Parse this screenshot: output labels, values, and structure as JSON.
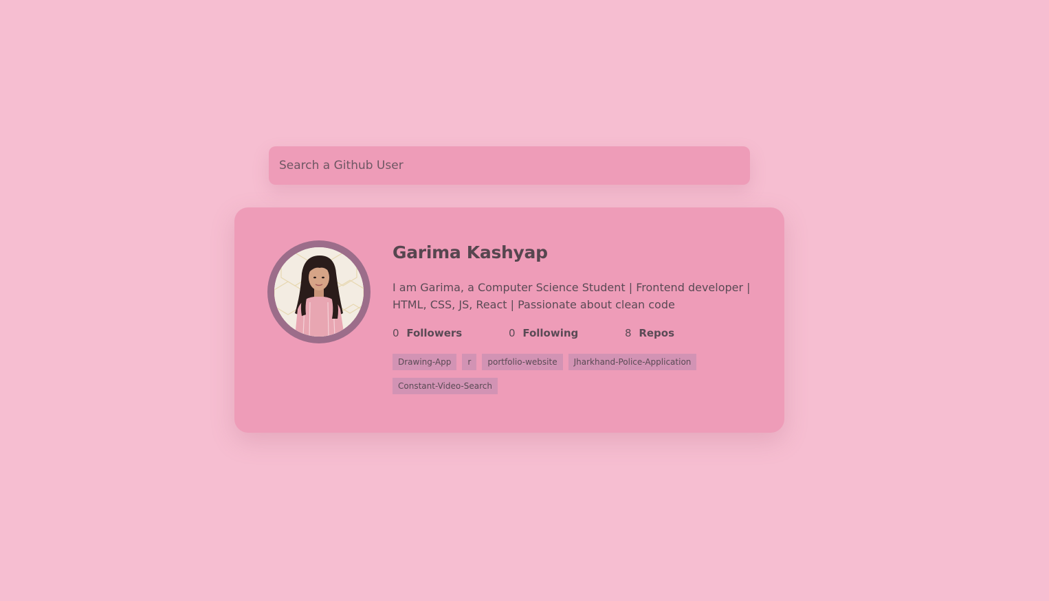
{
  "search": {
    "placeholder": "Search a Github User",
    "value": ""
  },
  "profile": {
    "name": "Garima Kashyap",
    "bio": "I am Garima, a Computer Science Student | Frontend developer | HTML, CSS, JS, React | Passionate about clean code",
    "avatar_icon": "user-avatar-photo",
    "stats": [
      {
        "count": "0",
        "label": "Followers"
      },
      {
        "count": "0",
        "label": "Following"
      },
      {
        "count": "8",
        "label": "Repos"
      }
    ],
    "repos": [
      "Drawing-App",
      "r",
      "portfolio-website",
      "Jharkhand-Police-Application",
      "Constant-Video-Search"
    ]
  },
  "colors": {
    "background": "#f6bed1",
    "card": "#ee9cb8",
    "avatar_ring": "#9c6d8a",
    "repo_tag": "#d293b4",
    "text": "#5a4a55"
  }
}
